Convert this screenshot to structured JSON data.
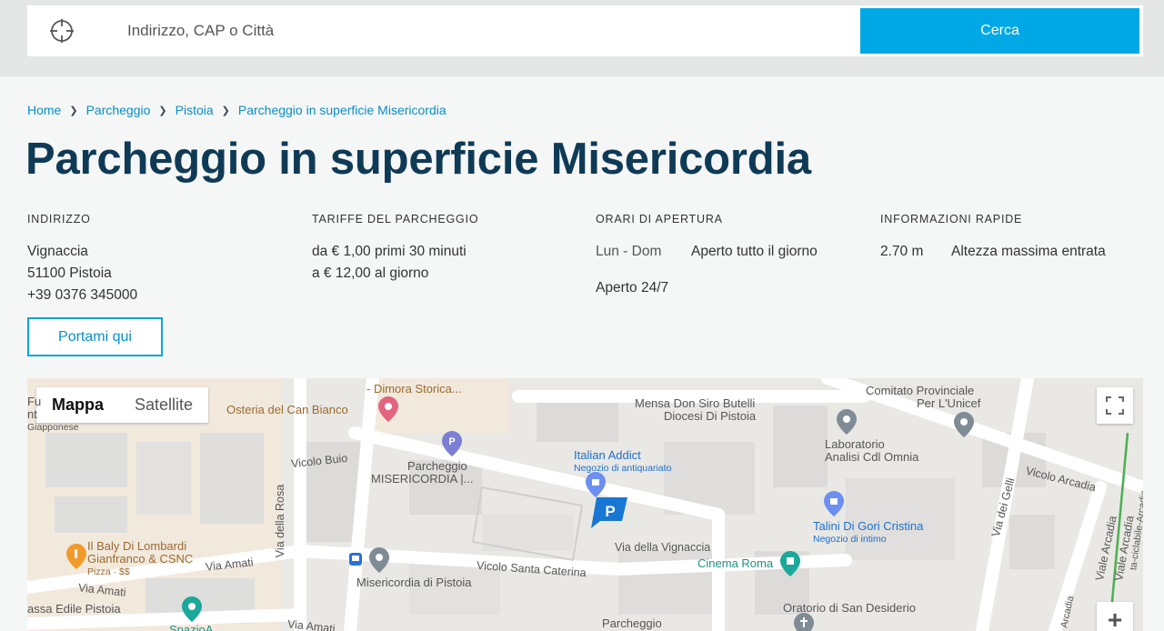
{
  "search": {
    "placeholder": "Indirizzo, CAP o Città",
    "button_label": "Cerca"
  },
  "breadcrumb": [
    "Home",
    "Parcheggio",
    "Pistoia",
    "Parcheggio in superficie Misericordia"
  ],
  "page_title": "Parcheggio in superficie Misericordia",
  "address": {
    "header": "INDIRIZZO",
    "street": "Vignaccia",
    "city": "51100 Pistoia",
    "phone": "+39 0376 345000"
  },
  "tariffs": {
    "header": "TARIFFE DEL PARCHEGGIO",
    "line1": "da € 1,00 primi 30 minuti",
    "line2": "a € 12,00 al giorno"
  },
  "hours": {
    "header": "ORARI DI APERTURA",
    "days": "Lun - Dom",
    "value": "Aperto tutto il giorno",
    "extra": "Aperto 24/7"
  },
  "quick_info": {
    "header": "INFORMAZIONI RAPIDE",
    "value": "2.70 m",
    "label": "Altezza massima entrata"
  },
  "directions_button": "Portami qui",
  "map": {
    "type_options": [
      "Mappa",
      "Satellite"
    ],
    "active_type": "Mappa",
    "zoom_in": "+",
    "parking_marker": "P",
    "labels": {
      "dimora": "- Dimora Storica...",
      "osteria": "Osteria del Can Bianco",
      "mensa1": "Mensa Don Siro Butelli",
      "mensa2": "Diocesi Di Pistoia",
      "comitato1": "Comitato Provinciale",
      "comitato2": "Per L'Unicef",
      "lab1": "Laboratorio",
      "lab2": "Analisi Cdl Omnia",
      "vicolo_buio": "Vicolo Buio",
      "parcheggio1": "Parcheggio",
      "parcheggio2": "MISERICORDIA |...",
      "italian": "Italian Addict",
      "italian_sub": "Negozio di antiquariato",
      "vicolo_arcadia": "Vicolo Arcadia",
      "via_gelli": "Via dei Gelli",
      "viale_arcadia": "Viale Arcadia",
      "viale_arcadia2": "Viale Arcadia",
      "ciclabile": "ta-ciclabile-Arcadia",
      "arcadia_short": "Arcadia",
      "talini": "Talini Di Gori Cristina",
      "talini_sub": "Negozio di intimo",
      "via_rosa": "Via della Rosa",
      "baly1": "Il Baly Di Lombardi",
      "baly2": "Gianfranco & CSNC",
      "baly_sub": "Pizza · $$",
      "via_amati1": "Via Amati",
      "via_amati2": "Via Amati",
      "via_amati3": "Via Amati",
      "vicolo_caterina": "Vicolo Santa Caterina",
      "via_vignaccia": "Via della Vignaccia",
      "cinema": "Cinema Roma",
      "misericordia": "Misericordia di Pistoia",
      "edile": "assa Edile Pistoia",
      "spazio": "SpazioA",
      "parcheggio_bottom": "Parcheggio",
      "oratorio": "Oratorio di San Desiderio",
      "left_edge1": "Fu",
      "left_edge2": "nt",
      "left_edge3": "Giapponese"
    }
  }
}
